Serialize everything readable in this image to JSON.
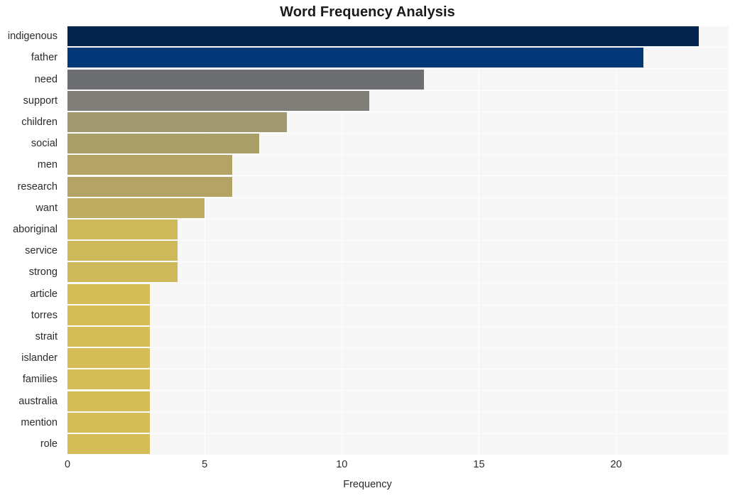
{
  "chart_data": {
    "type": "bar",
    "orientation": "horizontal",
    "title": "Word Frequency Analysis",
    "xlabel": "Frequency",
    "ylabel": "",
    "categories": [
      "indigenous",
      "father",
      "need",
      "support",
      "children",
      "social",
      "men",
      "research",
      "want",
      "aboriginal",
      "service",
      "strong",
      "article",
      "torres",
      "strait",
      "islander",
      "families",
      "australia",
      "mention",
      "role"
    ],
    "values": [
      23,
      21,
      13,
      11,
      8,
      7,
      6,
      6,
      5,
      4,
      4,
      4,
      3,
      3,
      3,
      3,
      3,
      3,
      3,
      3
    ],
    "bar_colors": [
      "#03244d",
      "#023877",
      "#6d6e72",
      "#7f7e79",
      "#a09871",
      "#ab9f69",
      "#b3a466",
      "#b3a466",
      "#bfae60",
      "#cdb95a",
      "#cdb95a",
      "#cdb95a",
      "#d4bd56",
      "#d4bd56",
      "#d4bd56",
      "#d4bd56",
      "#d4bd56",
      "#d4bd56",
      "#d4bd56",
      "#d4bd56"
    ],
    "x_ticks": [
      0,
      5,
      10,
      15,
      20
    ],
    "xlim": [
      0,
      24.1
    ],
    "grid": true,
    "grid_color": "#ffffff",
    "plot_background": "#f7f7f7",
    "legend": null
  }
}
